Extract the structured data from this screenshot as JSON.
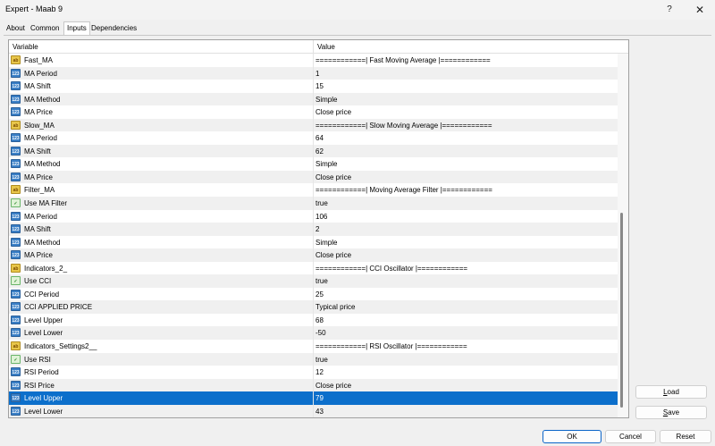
{
  "window": {
    "title": "Expert - Maab 9",
    "help_glyph": "?",
    "close_glyph": "✕"
  },
  "tabs": [
    {
      "label": "About"
    },
    {
      "label": "Common"
    },
    {
      "label": "Inputs"
    },
    {
      "label": "Dependencies"
    }
  ],
  "grid": {
    "col_variable": "Variable",
    "col_value": "Value",
    "rows": [
      {
        "type": "str",
        "name": "Fast_MA",
        "value": "============| Fast Moving Average |============"
      },
      {
        "type": "int",
        "name": "MA Period",
        "value": "1"
      },
      {
        "type": "int",
        "name": "MA Shift",
        "value": "15"
      },
      {
        "type": "int",
        "name": "MA Method",
        "value": "Simple"
      },
      {
        "type": "int",
        "name": "MA Price",
        "value": "Close price"
      },
      {
        "type": "str",
        "name": "Slow_MA",
        "value": "============| Slow Moving Average |============"
      },
      {
        "type": "int",
        "name": "MA Period",
        "value": "64"
      },
      {
        "type": "int",
        "name": "MA Shift",
        "value": "62"
      },
      {
        "type": "int",
        "name": "MA Method",
        "value": "Simple"
      },
      {
        "type": "int",
        "name": "MA Price",
        "value": "Close price"
      },
      {
        "type": "str",
        "name": "Filter_MA",
        "value": "============| Moving Average Filter |============"
      },
      {
        "type": "bool",
        "name": "Use MA Filter",
        "value": "true"
      },
      {
        "type": "int",
        "name": "MA Period",
        "value": "106"
      },
      {
        "type": "int",
        "name": "MA Shift",
        "value": "2"
      },
      {
        "type": "int",
        "name": "MA Method",
        "value": "Simple"
      },
      {
        "type": "int",
        "name": "MA Price",
        "value": "Close price"
      },
      {
        "type": "str",
        "name": "Indicators_2_",
        "value": "============| CCI Oscillator |============"
      },
      {
        "type": "bool",
        "name": "Use CCI",
        "value": "true"
      },
      {
        "type": "int",
        "name": "CCI Period",
        "value": "25"
      },
      {
        "type": "int",
        "name": "CCI APPLIED PRICE",
        "value": "Typical price"
      },
      {
        "type": "int",
        "name": "Level Upper",
        "value": "68"
      },
      {
        "type": "int",
        "name": "Level Lower",
        "value": "-50"
      },
      {
        "type": "str",
        "name": "Indicators_Settings2__",
        "value": "============| RSI Oscillator |============"
      },
      {
        "type": "bool",
        "name": "Use RSI",
        "value": "true"
      },
      {
        "type": "int",
        "name": "RSI Period",
        "value": "12"
      },
      {
        "type": "int",
        "name": "RSI Price",
        "value": "Close price"
      },
      {
        "type": "int",
        "name": "Level Upper",
        "value": "79",
        "selected": true
      },
      {
        "type": "int",
        "name": "Level Lower",
        "value": "43"
      }
    ]
  },
  "icons": {
    "int": "123",
    "str": "ab",
    "bool": "✓"
  },
  "buttons": {
    "load_pre": "",
    "load_u": "L",
    "load_post": "oad",
    "save_pre": "",
    "save_u": "S",
    "save_post": "ave",
    "ok": "OK",
    "cancel": "Cancel",
    "reset": "Reset"
  }
}
